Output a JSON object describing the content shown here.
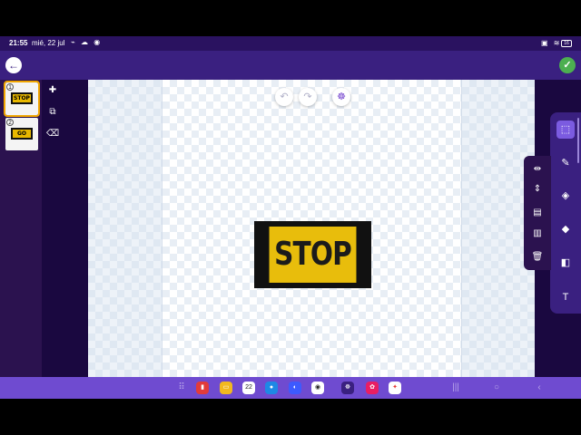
{
  "status_bar": {
    "time": "21:55",
    "date": "mié, 22 jul",
    "battery": "16"
  },
  "header": {
    "back_icon": "arrow-left-icon",
    "done_icon": "check-icon"
  },
  "frames": [
    {
      "number": "1",
      "label": "STOP",
      "selected": true
    },
    {
      "number": "2",
      "label": "GO",
      "selected": false
    }
  ],
  "canvas": {
    "sign_text": "STOP",
    "sign_color": "#e8bd0c",
    "border_color": "#111111"
  },
  "tools": [
    "select",
    "brush",
    "eraser",
    "fill",
    "shapes",
    "text"
  ],
  "text_tool_label": "T",
  "dock": {
    "calendar_day": "22"
  },
  "colors": {
    "accent": "#3a2080",
    "dock": "#6f4bd0",
    "done": "#4caf50",
    "frame_highlight": "#f0a500"
  }
}
